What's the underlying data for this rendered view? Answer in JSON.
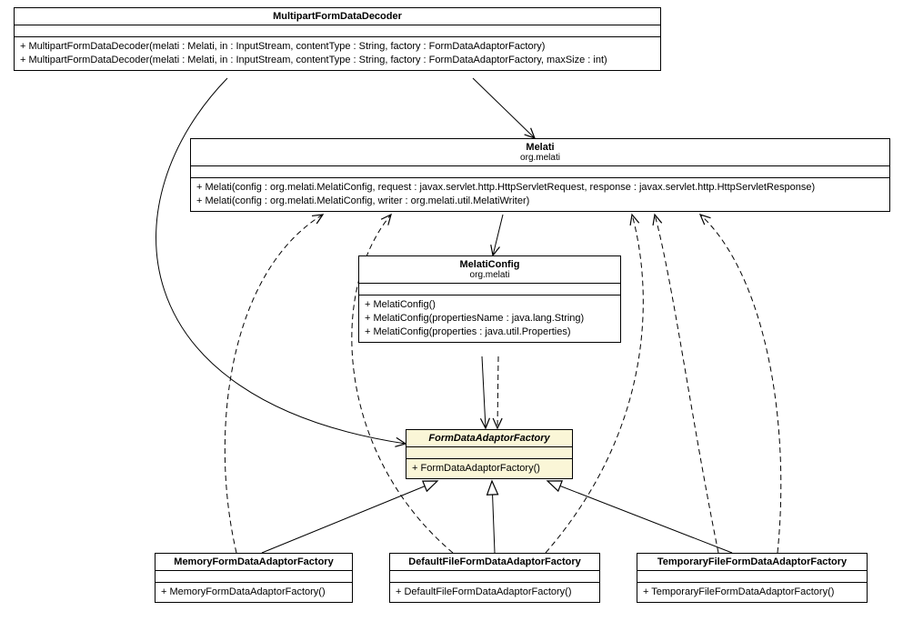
{
  "classes": {
    "mpfdd": {
      "name": "MultipartFormDataDecoder",
      "ops": [
        "+ MultipartFormDataDecoder(melati : Melati, in : InputStream, contentType : String, factory : FormDataAdaptorFactory)",
        "+ MultipartFormDataDecoder(melati : Melati, in : InputStream, contentType : String, factory : FormDataAdaptorFactory, maxSize : int)"
      ]
    },
    "melati": {
      "name": "Melati",
      "pkg": "org.melati",
      "ops": [
        "+ Melati(config : org.melati.MelatiConfig, request : javax.servlet.http.HttpServletRequest, response : javax.servlet.http.HttpServletResponse)",
        "+ Melati(config : org.melati.MelatiConfig, writer : org.melati.util.MelatiWriter)"
      ]
    },
    "mconfig": {
      "name": "MelatiConfig",
      "pkg": "org.melati",
      "ops": [
        "+ MelatiConfig()",
        "+ MelatiConfig(propertiesName : java.lang.String)",
        "+ MelatiConfig(properties : java.util.Properties)"
      ]
    },
    "fdaf": {
      "name": "FormDataAdaptorFactory",
      "ops": [
        "+ FormDataAdaptorFactory()"
      ]
    },
    "mem": {
      "name": "MemoryFormDataAdaptorFactory",
      "ops": [
        "+ MemoryFormDataAdaptorFactory()"
      ]
    },
    "def": {
      "name": "DefaultFileFormDataAdaptorFactory",
      "ops": [
        "+ DefaultFileFormDataAdaptorFactory()"
      ]
    },
    "tmp": {
      "name": "TemporaryFileFormDataAdaptorFactory",
      "ops": [
        "+ TemporaryFileFormDataAdaptorFactory()"
      ]
    }
  },
  "chart_data": {
    "type": "uml-class-diagram",
    "nodes": [
      {
        "id": "MultipartFormDataDecoder",
        "stereotype": "class"
      },
      {
        "id": "Melati",
        "package": "org.melati",
        "stereotype": "class"
      },
      {
        "id": "MelatiConfig",
        "package": "org.melati",
        "stereotype": "class"
      },
      {
        "id": "FormDataAdaptorFactory",
        "stereotype": "abstract-class",
        "highlighted": true
      },
      {
        "id": "MemoryFormDataAdaptorFactory",
        "stereotype": "class"
      },
      {
        "id": "DefaultFileFormDataAdaptorFactory",
        "stereotype": "class"
      },
      {
        "id": "TemporaryFileFormDataAdaptorFactory",
        "stereotype": "class"
      }
    ],
    "edges": [
      {
        "from": "MultipartFormDataDecoder",
        "to": "Melati",
        "kind": "association-solid-open"
      },
      {
        "from": "MultipartFormDataDecoder",
        "to": "FormDataAdaptorFactory",
        "kind": "association-solid-open"
      },
      {
        "from": "Melati",
        "to": "MelatiConfig",
        "kind": "association-solid-open"
      },
      {
        "from": "MelatiConfig",
        "to": "FormDataAdaptorFactory",
        "kind": "association-solid-open"
      },
      {
        "from": "MelatiConfig",
        "to": "FormDataAdaptorFactory",
        "kind": "dependency-dashed-open"
      },
      {
        "from": "MemoryFormDataAdaptorFactory",
        "to": "FormDataAdaptorFactory",
        "kind": "generalization"
      },
      {
        "from": "DefaultFileFormDataAdaptorFactory",
        "to": "FormDataAdaptorFactory",
        "kind": "generalization"
      },
      {
        "from": "TemporaryFileFormDataAdaptorFactory",
        "to": "FormDataAdaptorFactory",
        "kind": "generalization"
      },
      {
        "from": "MemoryFormDataAdaptorFactory",
        "to": "Melati",
        "kind": "dependency-dashed-open"
      },
      {
        "from": "DefaultFileFormDataAdaptorFactory",
        "to": "Melati",
        "kind": "dependency-dashed-open",
        "count": 2
      },
      {
        "from": "TemporaryFileFormDataAdaptorFactory",
        "to": "Melati",
        "kind": "dependency-dashed-open",
        "count": 2
      }
    ]
  }
}
